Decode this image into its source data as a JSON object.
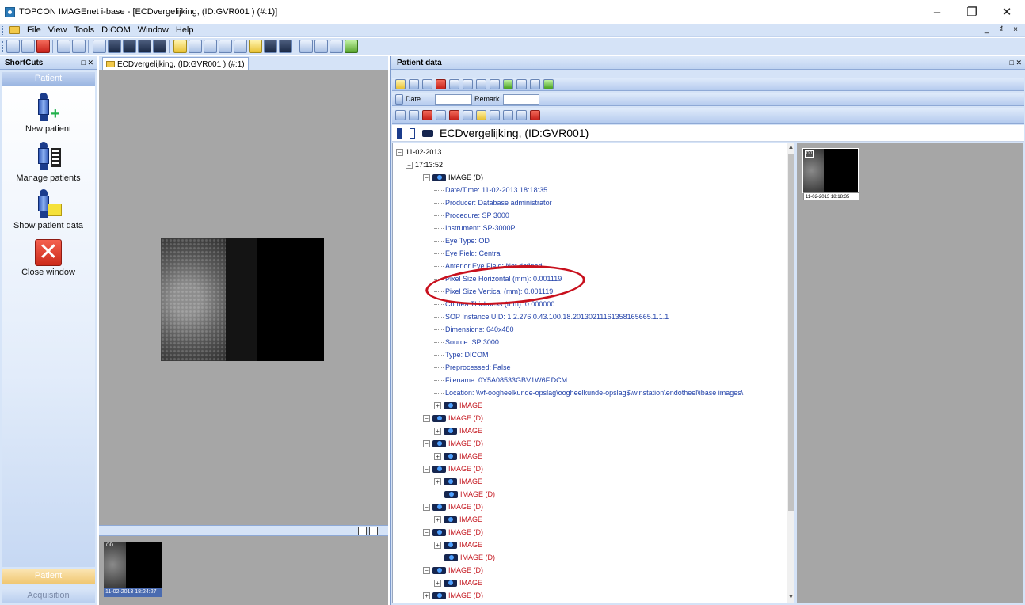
{
  "window": {
    "title": "TOPCON IMAGEnet i-base - [ECDvergelijking,  (ID:GVR001 ) (#:1)]",
    "controls": {
      "minimize": "–",
      "restore": "❐",
      "close": "✕"
    },
    "mdi_controls": "_ ₫ ×"
  },
  "menu": [
    {
      "label": "File"
    },
    {
      "label": "View"
    },
    {
      "label": "Tools"
    },
    {
      "label": "DICOM"
    },
    {
      "label": "Window"
    },
    {
      "label": "Help"
    }
  ],
  "shortcuts": {
    "header": "ShortCuts",
    "header_controls": "□ ✕",
    "group": "Patient",
    "items": [
      {
        "label": "New patient",
        "icon": "new-patient-icon"
      },
      {
        "label": "Manage patients",
        "icon": "manage-patients-icon"
      },
      {
        "label": "Show patient data",
        "icon": "show-patient-data-icon"
      },
      {
        "label": "Close window",
        "icon": "close-window-icon"
      }
    ],
    "nav_bottom": [
      "Patient",
      "Acquisition"
    ]
  },
  "document_tab": {
    "label": "ECDvergelijking,  (ID:GVR001 ) (#:1)"
  },
  "image_strip": {
    "thumb_tag": "OD",
    "thumb_caption": "11-02-2013 18:24:27"
  },
  "patient_data": {
    "header": "Patient data",
    "header_controls": "□ ✕",
    "filter": {
      "date_label": "Date",
      "remark_label": "Remark",
      "date_value": "",
      "remark_value": ""
    },
    "patient_name": "ECDvergelijking,  (ID:GVR001)",
    "tree": {
      "date": "11-02-2013",
      "time": "17:13:52",
      "expanded_image": "IMAGE (D)",
      "details": [
        "Date/Time: 11-02-2013 18:18:35",
        "Producer: Database administrator",
        "Procedure: SP 3000",
        "Instrument: SP-3000P",
        "Eye Type: OD",
        "Eye Field: Central",
        "Anterior Eye Field: Not defined",
        "Pixel Size Horizontal (mm): 0.001119",
        "Pixel Size Vertical (mm): 0.001119",
        "Cornea Thickness (mm): 0.000000",
        "SOP Instance UID: 1.2.276.0.43.100.18.20130211161358165665.1.1.1",
        "Dimensions: 640x480",
        "Source: SP 3000",
        "Type: DICOM",
        "Preprocessed: False",
        "Filename: 0Y5A08533GBV1W6F.DCM",
        "Location: \\\\vf-oogheelkunde-opslag\\oogheelkunde-opslag$\\winstation\\endotheel\\ibase images\\"
      ],
      "child_image": "IMAGE",
      "image_d": "IMAGE (D)"
    },
    "thumbnail": {
      "tag": "OD",
      "caption": "11-02-2013 18:18:35"
    }
  },
  "colors": {
    "accent": "#d5e3f7",
    "highlight_oval": "#c8101d",
    "tree_blue": "#1f3fa8",
    "tree_red": "#c4171f"
  }
}
